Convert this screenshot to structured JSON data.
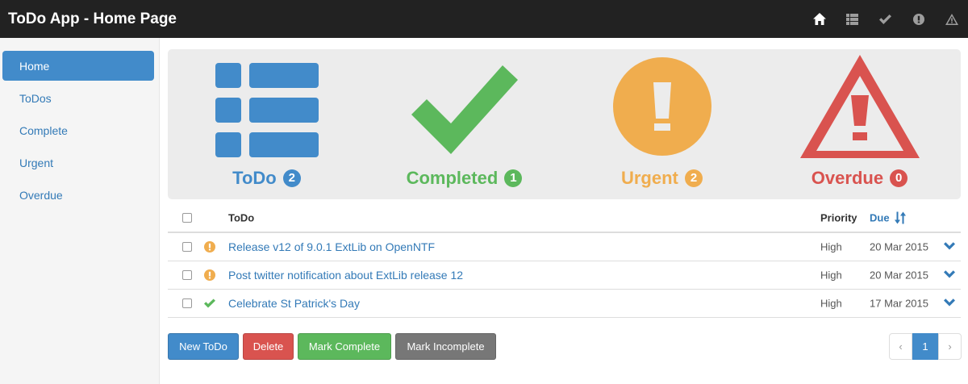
{
  "app": {
    "title": "ToDo App - Home Page"
  },
  "navbar": {
    "icons": [
      "home-icon",
      "list-icon",
      "check-icon",
      "exclamation-circle-icon",
      "warning-icon"
    ]
  },
  "sidebar": {
    "items": [
      {
        "label": "Home",
        "active": true
      },
      {
        "label": "ToDos",
        "active": false
      },
      {
        "label": "Complete",
        "active": false
      },
      {
        "label": "Urgent",
        "active": false
      },
      {
        "label": "Overdue",
        "active": false
      }
    ]
  },
  "dashboard": {
    "tiles": [
      {
        "label": "ToDo",
        "count": "2",
        "color": "#428bca",
        "icon": "list-icon"
      },
      {
        "label": "Completed",
        "count": "1",
        "color": "#5cb85c",
        "icon": "check-icon"
      },
      {
        "label": "Urgent",
        "count": "2",
        "color": "#f0ad4e",
        "icon": "exclamation-circle-icon"
      },
      {
        "label": "Overdue",
        "count": "0",
        "color": "#d9534f",
        "icon": "warning-icon"
      }
    ]
  },
  "table": {
    "headers": {
      "todo": "ToDo",
      "priority": "Priority",
      "due": "Due"
    },
    "rows": [
      {
        "title": "Release v12 of 9.0.1 ExtLib on OpenNTF",
        "priority": "High",
        "due": "20 Mar 2015",
        "status": "urgent"
      },
      {
        "title": "Post twitter notification about ExtLib release 12",
        "priority": "High",
        "due": "20 Mar 2015",
        "status": "urgent"
      },
      {
        "title": "Celebrate St Patrick's Day",
        "priority": "High",
        "due": "17 Mar 2015",
        "status": "complete"
      }
    ]
  },
  "actions": {
    "new_todo": "New ToDo",
    "delete": "Delete",
    "mark_complete": "Mark Complete",
    "mark_incomplete": "Mark Incomplete"
  },
  "pagination": {
    "prev": "‹",
    "page": "1",
    "next": "›"
  },
  "colors": {
    "navbar": "#222222",
    "primary": "#428bca",
    "success": "#5cb85c",
    "warning": "#f0ad4e",
    "danger": "#d9534f",
    "default_dark": "#777777",
    "link": "#337ab7"
  }
}
